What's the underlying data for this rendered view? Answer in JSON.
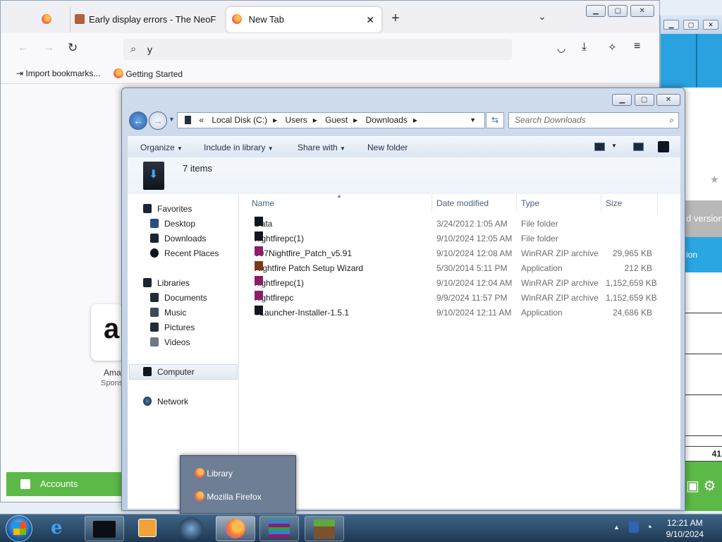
{
  "firefox": {
    "tabs": [
      {
        "label": ""
      },
      {
        "label": "Early display errors - The NeoF"
      },
      {
        "label": "New Tab",
        "active": true
      }
    ],
    "url_value": "y",
    "bookmarks": [
      {
        "label": "Import bookmarks..."
      },
      {
        "label": "Getting Started"
      }
    ],
    "shortcut": {
      "label": "Ama",
      "sponsor": "Spons"
    },
    "accounts_label": "Accounts"
  },
  "bg_window": {
    "grey_text": "d version",
    "blue_text": "ion",
    "number": "41"
  },
  "explorer": {
    "breadcrumb": [
      "Local Disk (C:)",
      "Users",
      "Guest",
      "Downloads"
    ],
    "search_placeholder": "Search Downloads",
    "commands": {
      "organize": "Organize",
      "include": "Include in library",
      "share": "Share with",
      "new_folder": "New folder"
    },
    "item_count": "7 items",
    "nav": {
      "favorites": "Favorites",
      "desktop": "Desktop",
      "downloads": "Downloads",
      "recent": "Recent Places",
      "libraries": "Libraries",
      "documents": "Documents",
      "music": "Music",
      "pictures": "Pictures",
      "videos": "Videos",
      "computer": "Computer",
      "network": "Network"
    },
    "columns": {
      "name": "Name",
      "date": "Date modified",
      "type": "Type",
      "size": "Size"
    },
    "files": [
      {
        "name": "Data",
        "date": "3/24/2012 1:05 AM",
        "type": "File folder",
        "size": "",
        "icon": "folder-icon"
      },
      {
        "name": "nightfirepc(1)",
        "date": "9/10/2024 12:05 AM",
        "type": "File folder",
        "size": "",
        "icon": "folder-icon"
      },
      {
        "name": "007Nightfire_Patch_v5.91",
        "date": "9/10/2024 12:08 AM",
        "type": "WinRAR ZIP archive",
        "size": "29,965 KB",
        "icon": "winrar-icon"
      },
      {
        "name": "Nightfire Patch Setup Wizard",
        "date": "5/30/2014 5:11 PM",
        "type": "Application",
        "size": "212 KB",
        "icon": "setup-icon"
      },
      {
        "name": "nightfirepc(1)",
        "date": "9/10/2024 12:04 AM",
        "type": "WinRAR ZIP archive",
        "size": "1,152,659 KB",
        "icon": "winrar-icon"
      },
      {
        "name": "nightfirepc",
        "date": "9/9/2024 11:57 PM",
        "type": "WinRAR ZIP archive",
        "size": "1,152,659 KB",
        "icon": "winrar-icon"
      },
      {
        "name": "TLauncher-Installer-1.5.1",
        "date": "9/10/2024 12:11 AM",
        "type": "Application",
        "size": "24,686 KB",
        "icon": "tlauncher-icon"
      }
    ]
  },
  "jumplist": {
    "items": [
      "Library",
      "Mozilla Firefox"
    ]
  },
  "taskbar": {
    "time": "12:21 AM",
    "date": "9/10/2024"
  }
}
